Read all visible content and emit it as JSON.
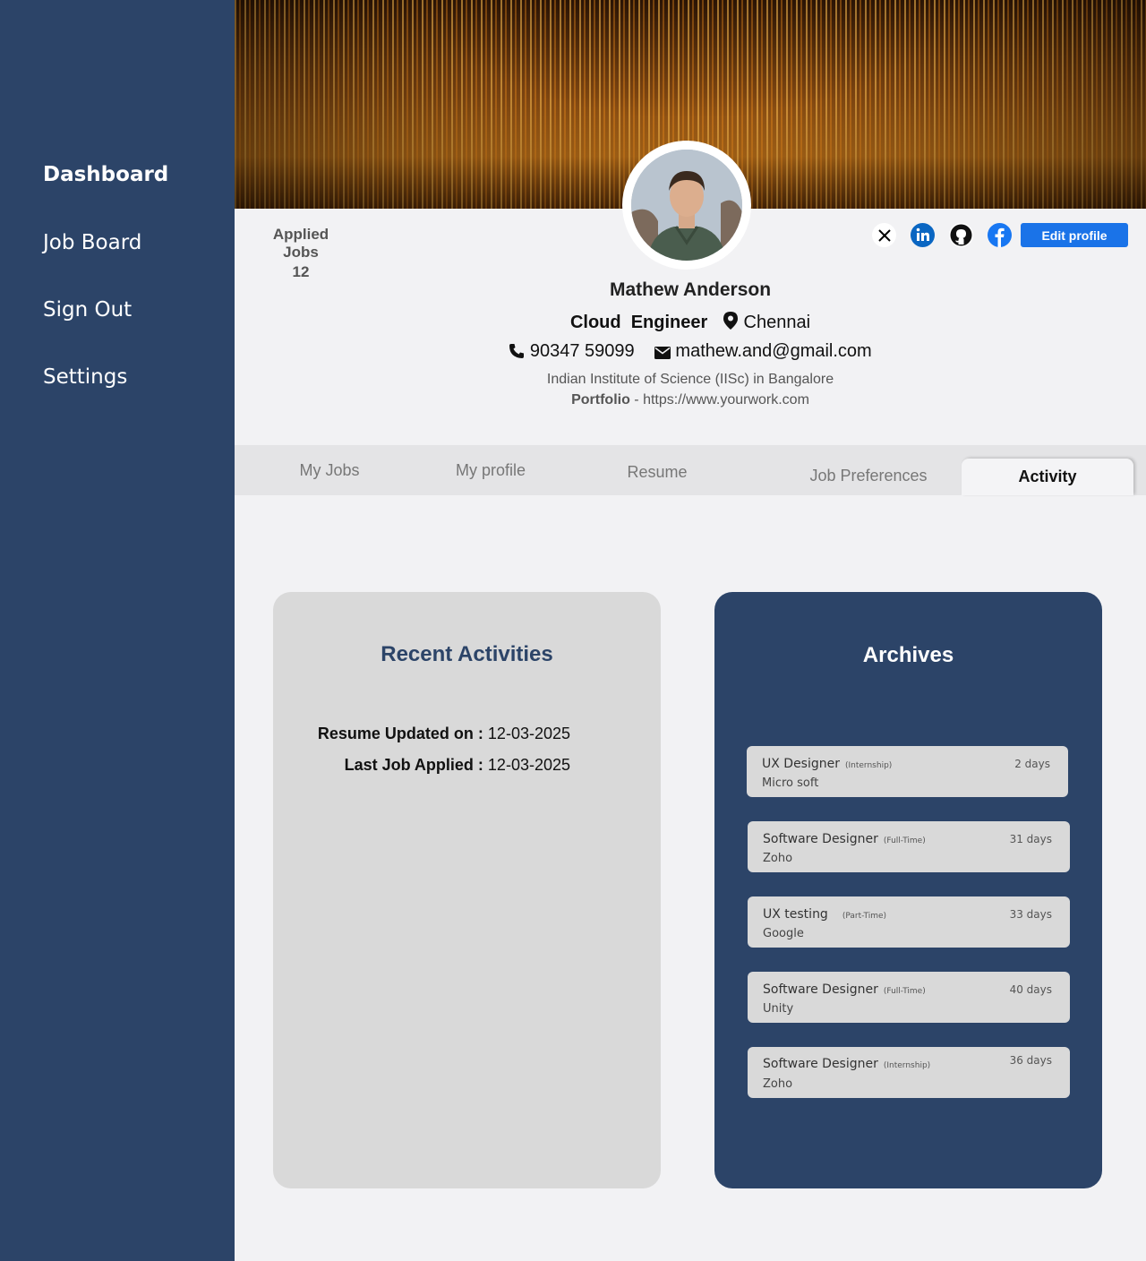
{
  "sidebar": {
    "items": [
      {
        "label": "Dashboard",
        "active": true
      },
      {
        "label": "Job Board"
      },
      {
        "label": "Sign Out"
      },
      {
        "label": "Settings"
      }
    ]
  },
  "profile": {
    "applied_label": "Applied Jobs",
    "applied_count": "12",
    "name": "Mathew Anderson",
    "role_first": "Cloud",
    "role_second": "Engineer",
    "location": "Chennai",
    "phone": "90347 59099",
    "email": "mathew.and@gmail.com",
    "education": "Indian Institute of Science (IISc) in Bangalore",
    "portfolio_label": "Portfolio",
    "portfolio_sep": " - ",
    "portfolio_url": "https://www.yourwork.com",
    "edit_button": "Edit profile"
  },
  "socials": [
    "x-icon",
    "linkedin-icon",
    "github-icon",
    "facebook-icon"
  ],
  "tabs": [
    {
      "label": "My Jobs"
    },
    {
      "label": "My profile"
    },
    {
      "label": "Resume"
    },
    {
      "label": "Job Preferences"
    },
    {
      "label": "Activity",
      "active": true
    }
  ],
  "recent": {
    "title": "Recent Activities",
    "rows": [
      {
        "label": "Resume Updated on :",
        "value": " 12-03-2025"
      },
      {
        "label": "Last Job Applied :",
        "value": " 12-03-2025"
      }
    ]
  },
  "archives": {
    "title": "Archives",
    "jobs": [
      {
        "title": "UX Designer",
        "type": "(Internship)",
        "company": "Micro soft",
        "age": "2 days"
      },
      {
        "title": "Software Designer",
        "type": "(Full-Time)",
        "company": "Zoho",
        "age": "31 days"
      },
      {
        "title": "UX testing",
        "type": "(Part-Time)",
        "company": "Google",
        "age": "33 days"
      },
      {
        "title": "Software Designer",
        "type": "(Full-Time)",
        "company": "Unity",
        "age": "40 days"
      },
      {
        "title": "Software Designer",
        "type": "(Internship)",
        "company": "Zoho",
        "age": "36 days"
      }
    ]
  },
  "colors": {
    "sidebar": "#2c4468",
    "accent": "#1a73e8",
    "card_light": "#d9d9d9",
    "background": "#f2f2f4"
  }
}
